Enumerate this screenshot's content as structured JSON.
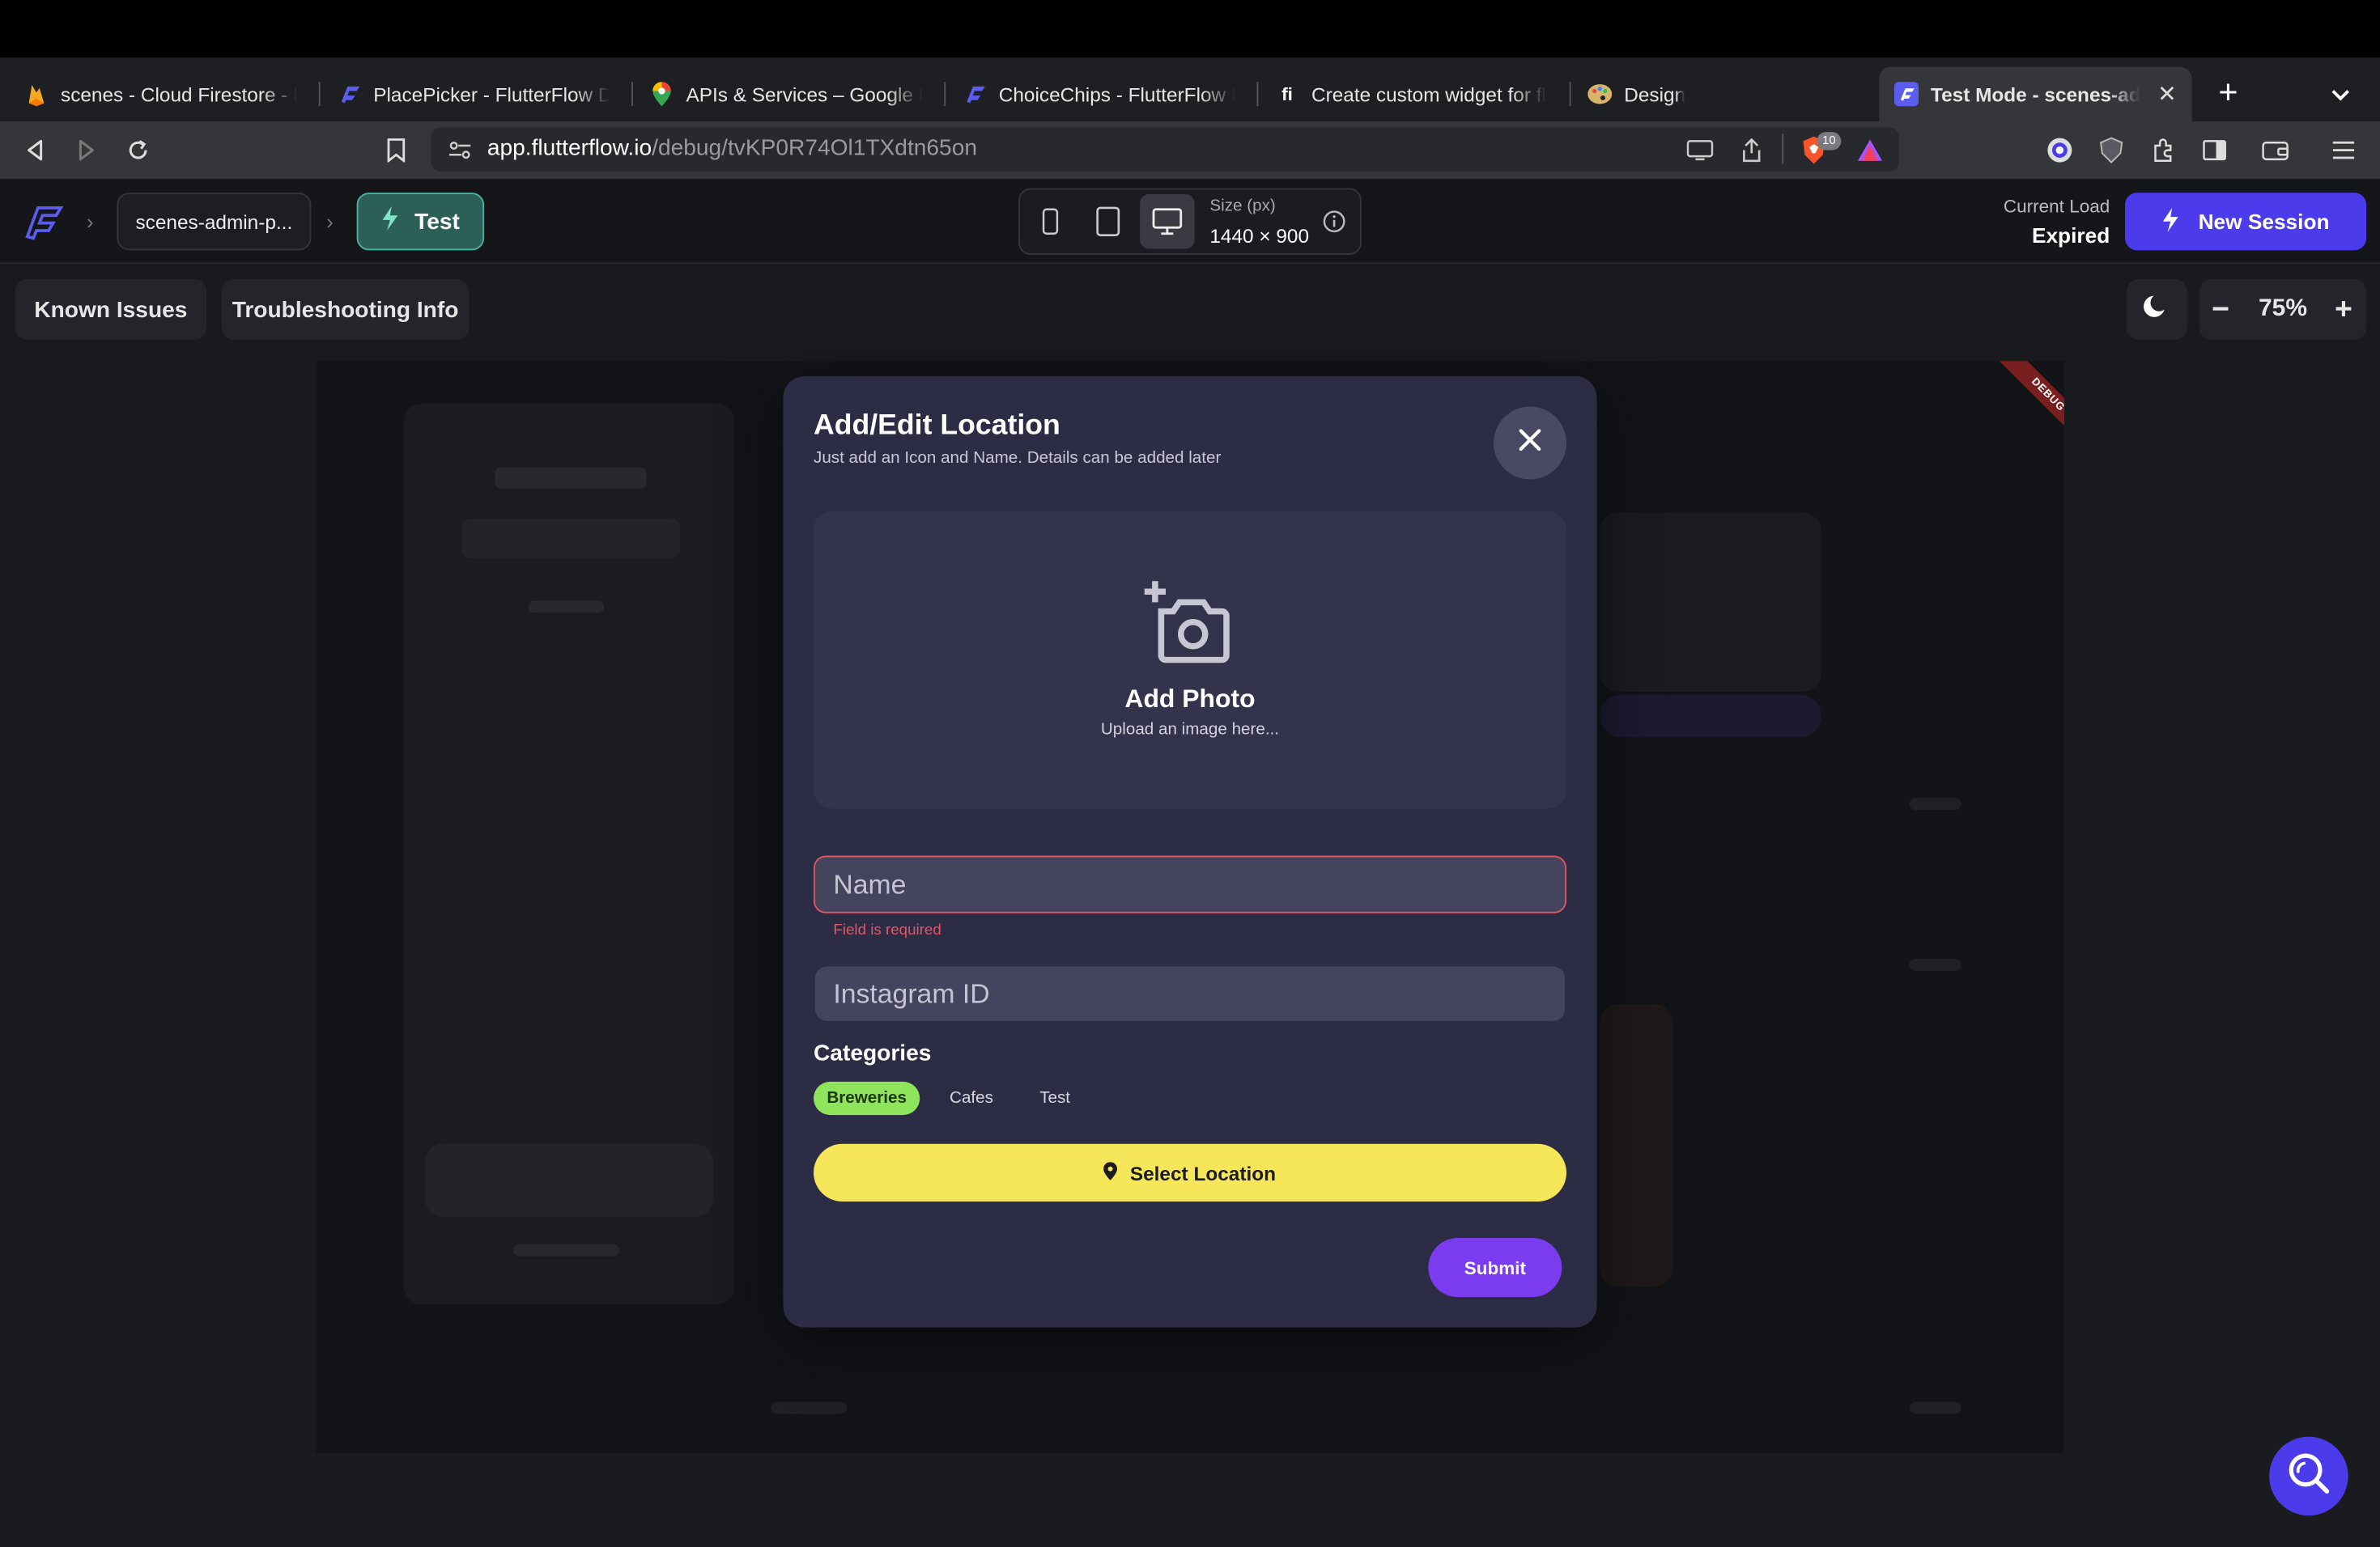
{
  "browser": {
    "tabs": [
      {
        "title": "scenes - Cloud Firestore - D",
        "icon": "firebase-icon"
      },
      {
        "title": "PlacePicker - FlutterFlow D",
        "icon": "flutterflow-icon"
      },
      {
        "title": "APIs & Services – Google M",
        "icon": "google-maps-icon"
      },
      {
        "title": "ChoiceChips - FlutterFlow D",
        "icon": "flutterflow-icon"
      },
      {
        "title": "Create custom widget for fl",
        "icon": "fi-icon"
      },
      {
        "title": "Design",
        "icon": "palette-icon"
      },
      {
        "title": "Test Mode - scenes-ad",
        "icon": "flutterflow-icon",
        "active": true
      }
    ],
    "new_tab": "+",
    "url_host": "app.flutterflow.io",
    "url_path": "/debug/tvKP0R74Ol1TXdtn65on",
    "brave_badge": "10"
  },
  "ff_header": {
    "project": "scenes-admin-p...",
    "mode": "Test",
    "size_label": "Size (px)",
    "size_value": "1440 × 900",
    "load_label": "Current Load",
    "load_value": "Expired",
    "new_session": "New Session"
  },
  "toolbar": {
    "known_issues": "Known Issues",
    "troubleshooting": "Troubleshooting Info",
    "zoom": "75%",
    "zoom_minus": "−",
    "zoom_plus": "+"
  },
  "debug_ribbon": "DEBUG",
  "modal": {
    "title": "Add/Edit Location",
    "subtitle": "Just add an Icon and Name. Details can be added later",
    "photo_title": "Add Photo",
    "photo_subtitle": "Upload an image here...",
    "name_placeholder": "Name",
    "name_error": "Field is required",
    "instagram_placeholder": "Instagram ID",
    "categories_title": "Categories",
    "chips": [
      {
        "label": "Breweries",
        "selected": true
      },
      {
        "label": "Cafes",
        "selected": false
      },
      {
        "label": "Test",
        "selected": false
      }
    ],
    "select_location": "Select Location",
    "submit": "Submit"
  },
  "colors": {
    "accent": "#4b3bea",
    "chip_selected": "#8ee45a",
    "select_location": "#f5e65a",
    "submit": "#7b3cf0",
    "error": "#e25563"
  }
}
